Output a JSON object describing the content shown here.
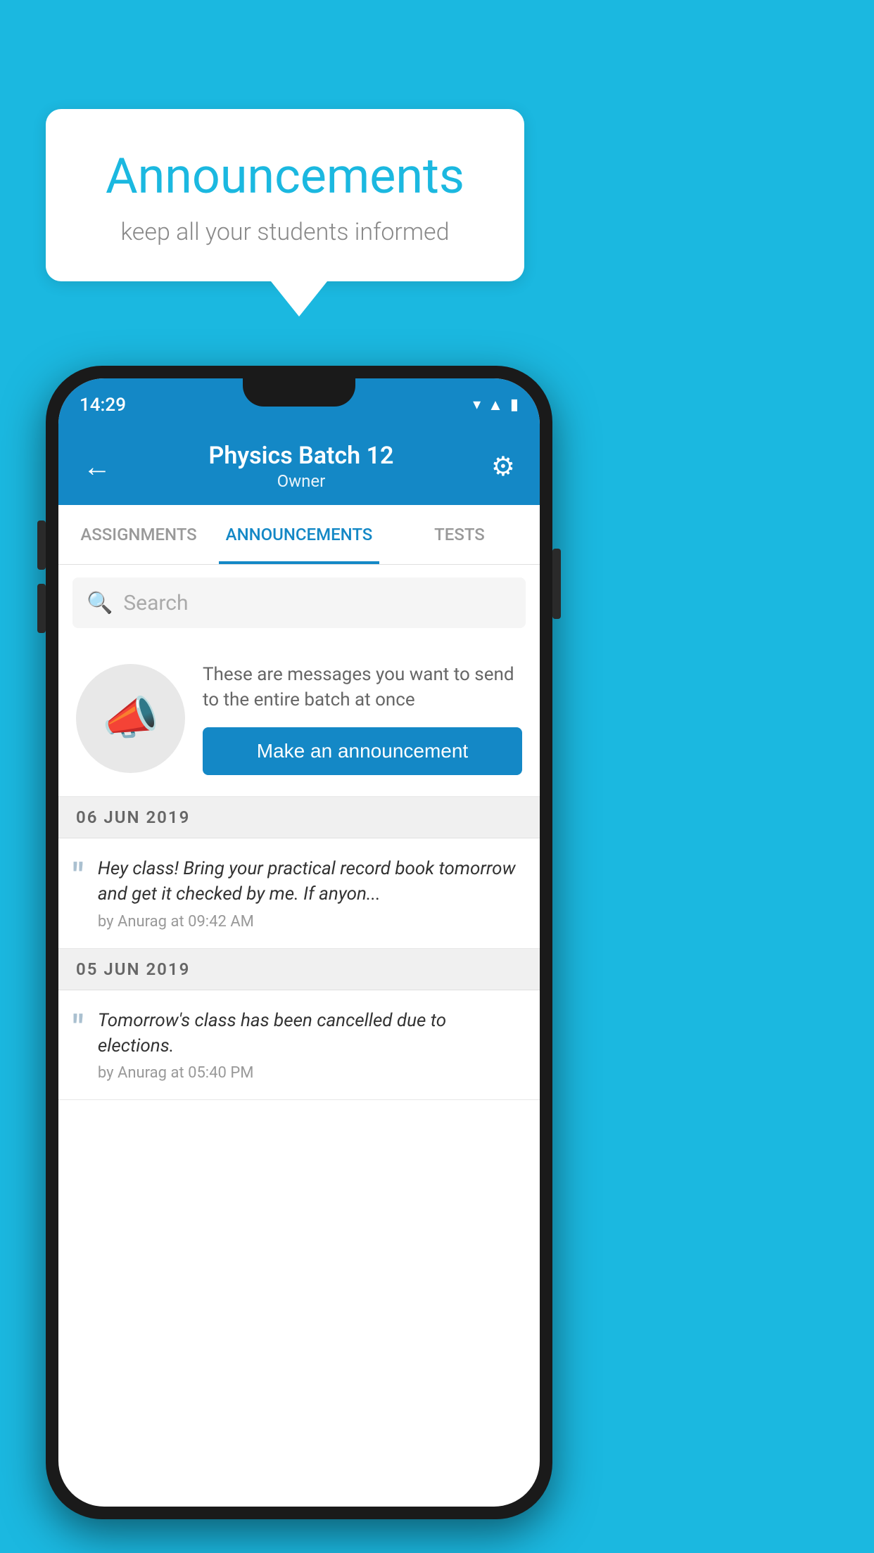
{
  "background_color": "#1bb8e0",
  "speech_bubble": {
    "title": "Announcements",
    "subtitle": "keep all your students informed"
  },
  "phone": {
    "status_bar": {
      "time": "14:29"
    },
    "app_bar": {
      "title": "Physics Batch 12",
      "subtitle": "Owner",
      "back_label": "←",
      "settings_label": "⚙"
    },
    "tabs": [
      {
        "label": "ASSIGNMENTS",
        "active": false
      },
      {
        "label": "ANNOUNCEMENTS",
        "active": true
      },
      {
        "label": "TESTS",
        "active": false
      }
    ],
    "search": {
      "placeholder": "Search"
    },
    "cta": {
      "description": "These are messages you want to send to the entire batch at once",
      "button_label": "Make an announcement"
    },
    "messages": [
      {
        "date": "06  JUN  2019",
        "text": "Hey class! Bring your practical record book tomorrow and get it checked by me. If anyon...",
        "meta": "by Anurag at 09:42 AM"
      },
      {
        "date": "05  JUN  2019",
        "text": "Tomorrow's class has been cancelled due to elections.",
        "meta": "by Anurag at 05:40 PM"
      }
    ]
  }
}
